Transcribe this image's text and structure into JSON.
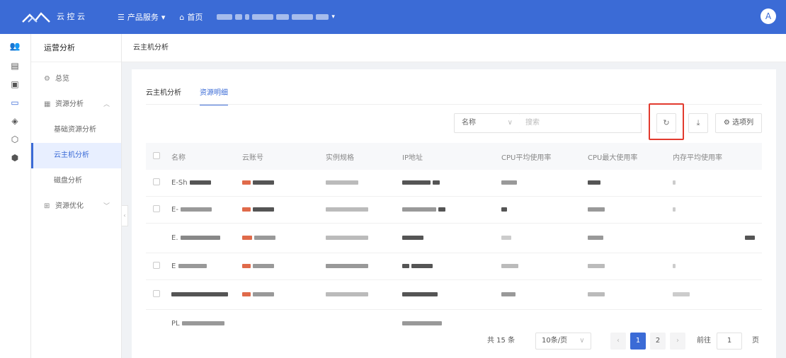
{
  "topbar": {
    "brand": "云 控 云",
    "menu_products": "产品服务",
    "menu_home": "首页",
    "avatar_initial": "A"
  },
  "sidebar": {
    "title": "运营分析",
    "items": [
      {
        "label": "总览"
      },
      {
        "label": "资源分析"
      },
      {
        "label": "基础资源分析"
      },
      {
        "label": "云主机分析"
      },
      {
        "label": "磁盘分析"
      },
      {
        "label": "资源优化"
      }
    ]
  },
  "breadcrumb": "云主机分析",
  "tabs": [
    "云主机分析",
    "资源明细"
  ],
  "toolbar": {
    "filter_field": "名称",
    "search_placeholder": "搜索",
    "columns_button": "选项列"
  },
  "table": {
    "headers": [
      "名称",
      "云账号",
      "实例规格",
      "IP地址",
      "CPU平均使用率",
      "CPU最大使用率",
      "内存平均使用率"
    ],
    "rows": [
      {
        "name": "E-Sh"
      },
      {
        "name": "E-"
      },
      {
        "name": "E."
      },
      {
        "name": "E"
      },
      {
        "name": ""
      },
      {
        "name": "PL"
      }
    ]
  },
  "pagination": {
    "total": "共 15 条",
    "page_size": "10条/页",
    "pages": [
      "1",
      "2"
    ],
    "current": "1",
    "goto_label": "前往",
    "goto_value": "1",
    "page_unit": "页"
  },
  "colors": {
    "brand": "#3b6bd6",
    "highlight_box": "#e23a2e"
  }
}
